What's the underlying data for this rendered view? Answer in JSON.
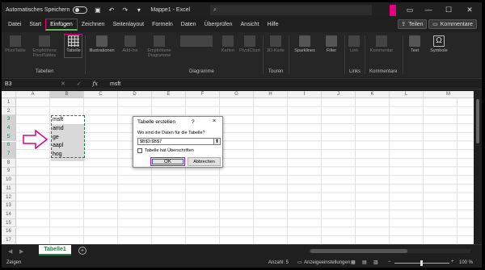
{
  "titlebar": {
    "autosave_label": "Automatisches Speichern",
    "file_title": "Mappe1 - Excel",
    "search_placeholder": "",
    "minimize_icon": "minimize-icon",
    "maximize_icon": "maximize-icon",
    "close_icon": "close-icon"
  },
  "tabs": [
    "Datei",
    "Start",
    "Einfügen",
    "Zeichnen",
    "Seitenlayout",
    "Formeln",
    "Daten",
    "Überprüfen",
    "Ansicht",
    "Hilfe"
  ],
  "active_tab": "Einfügen",
  "share_label": "Teilen",
  "comments_label": "Kommentare",
  "ribbon": {
    "pivot1": "PivotTable",
    "pivot2": "Empfohlene PivotTables",
    "table": "Tabelle",
    "illustrations": "Illustrationen",
    "addins": "Add-Ins",
    "rec_charts": "Empfohlene Diagramme",
    "maps": "Karten",
    "pivotchart": "PivotChart",
    "map3d": "3D-Karte",
    "sparklines": "Sparklines",
    "filter": "Filter",
    "link": "Link",
    "comment": "Kommentar",
    "text": "Text",
    "symbols": "Symbole",
    "group_tables": "Tabellen",
    "group_charts": "Diagramme",
    "group_tours": "Touren",
    "group_links": "Links",
    "group_comments": "Kommentare"
  },
  "formula_bar": {
    "name_box": "B3",
    "fx_label": "fx",
    "value": "msft"
  },
  "columns": [
    "A",
    "B",
    "C",
    "D",
    "E",
    "F",
    "G",
    "H",
    "I",
    "J",
    "K",
    "L",
    "M"
  ],
  "rows": [
    "1",
    "2",
    "3",
    "4",
    "5",
    "6",
    "7",
    "8",
    "9",
    "10",
    "11",
    "12",
    "13",
    "14",
    "15",
    "16",
    "17"
  ],
  "cells": {
    "B3": "msft",
    "B4": "amd",
    "B5": "ge",
    "B6": "aapl",
    "B7": "hog"
  },
  "dialog": {
    "title": "Tabelle erstellen",
    "help": "?",
    "close": "×",
    "prompt": "Wo sind die Daten für die Tabelle?",
    "range": "$B$3:$B$7",
    "header_checkbox": "Tabelle hat Überschriften",
    "ok": "OK",
    "cancel": "Abbrechen"
  },
  "sheet_tab": "Tabelle1",
  "statusbar": {
    "mode": "Zeigen",
    "count": "Anzahl: 5",
    "display_settings": "Anzeigeeinstellungen",
    "zoom": "100 %"
  },
  "colors": {
    "accent_pink": "#e4007f",
    "excel_green": "#1e7b45",
    "dark_bg": "#1f1f1f"
  }
}
